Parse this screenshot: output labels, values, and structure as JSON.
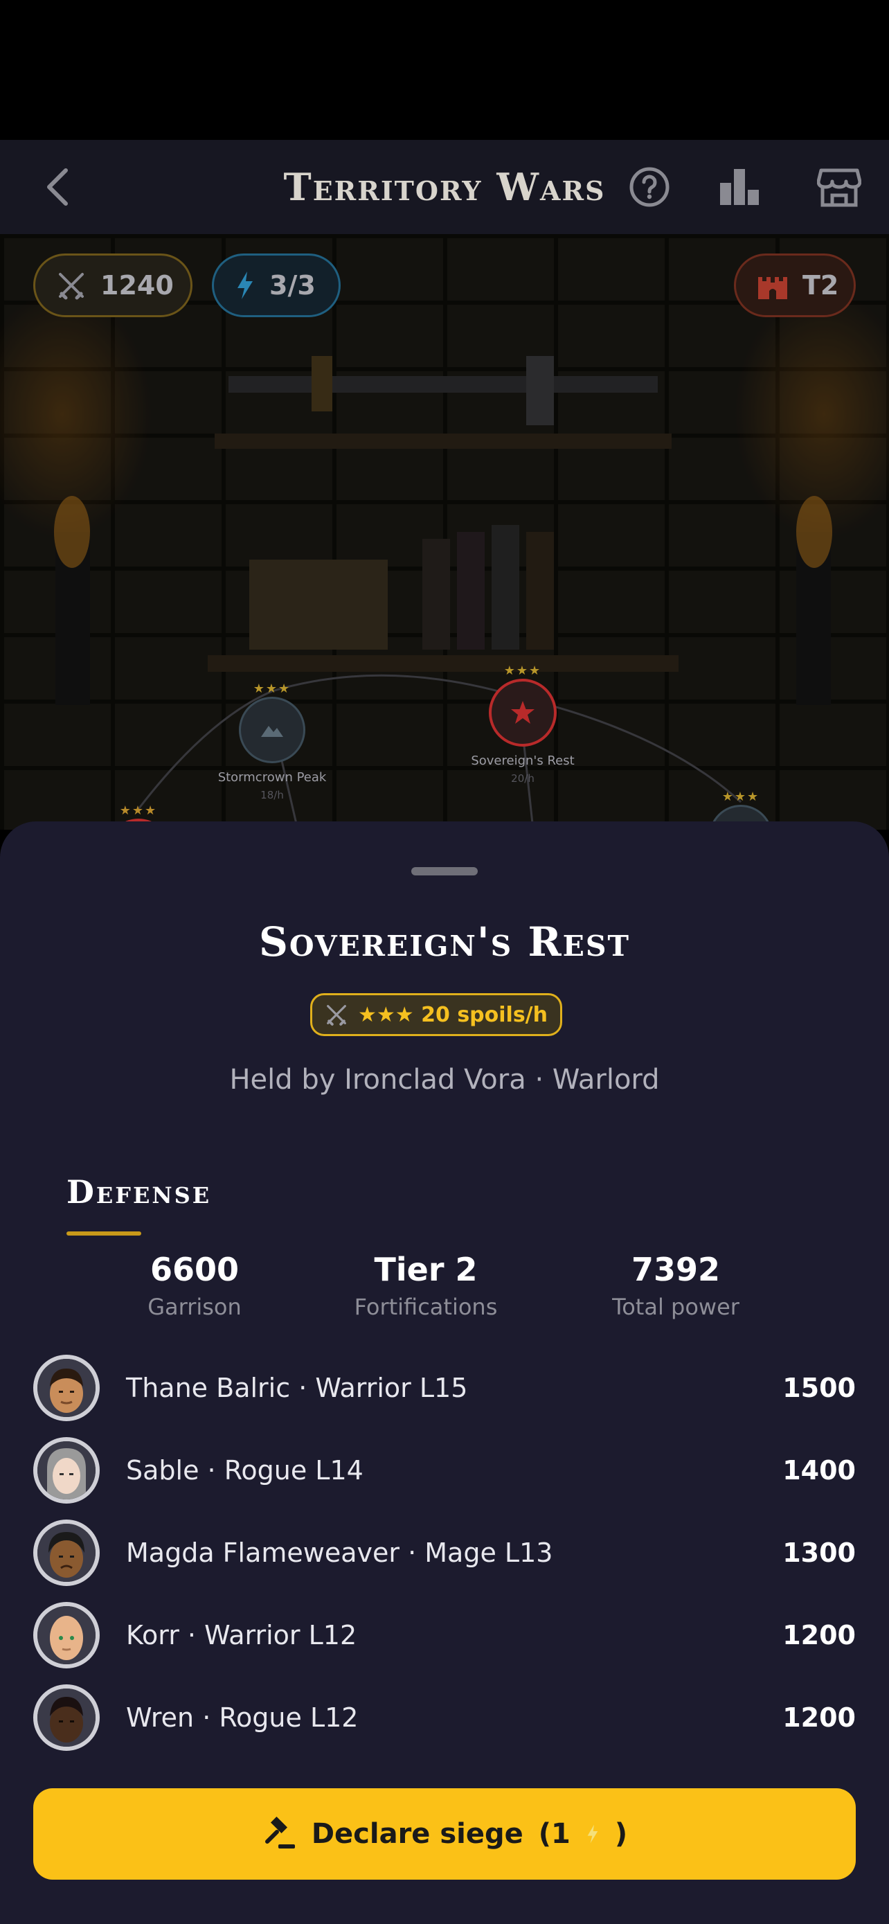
{
  "header": {
    "title": "Territory Wars"
  },
  "resources": {
    "spoils": "1240",
    "energy": "3/3",
    "tier": "T2"
  },
  "map_nodes": [
    {
      "name": "Stormcrown Peak",
      "rate": "18/h",
      "stars": "★★★",
      "icon": "mountain-icon",
      "color": "#3a4a55"
    },
    {
      "name": "Sovereign's Rest",
      "rate": "20/h",
      "stars": "★★★",
      "icon": "star-icon",
      "color": "#b82a2a"
    },
    {
      "name": "",
      "rate": "",
      "stars": "★★★",
      "icon": "fire-icon",
      "color": "#b82a2a"
    },
    {
      "name": "",
      "rate": "",
      "stars": "★★★",
      "icon": "tower-icon",
      "color": "#3a4a55"
    }
  ],
  "territory": {
    "name": "Sovereign's Rest",
    "spoils_badge": "★★★ 20 spoils/h",
    "held_by": "Held by Ironclad Vora · Warlord"
  },
  "defense": {
    "title": "Defense",
    "stats": [
      {
        "value": "6600",
        "label": "Garrison"
      },
      {
        "value": "Tier 2",
        "label": "Fortifications"
      },
      {
        "value": "7392",
        "label": "Total power"
      }
    ],
    "defenders": [
      {
        "name": "Thane Balric · Warrior L15",
        "power": "1500",
        "skin": "#c98d5a",
        "hair": "#2a1a10"
      },
      {
        "name": "Sable · Rogue L14",
        "power": "1400",
        "skin": "#f0d8c8",
        "hair": "#9a9a9a"
      },
      {
        "name": "Magda Flameweaver · Mage L13",
        "power": "1300",
        "skin": "#8a5a30",
        "hair": "#1a1a1a"
      },
      {
        "name": "Korr · Warrior L12",
        "power": "1200",
        "skin": "#e8b48a",
        "hair": "#e8b48a"
      },
      {
        "name": "Wren · Rogue L12",
        "power": "1200",
        "skin": "#4a2e1c",
        "hair": "#1a1010"
      }
    ]
  },
  "action": {
    "label": "Declare siege",
    "cost_open": "(1",
    "cost_close": ")"
  },
  "colors": {
    "accent": "#fbc117",
    "sheet": "#1c1b2e"
  }
}
